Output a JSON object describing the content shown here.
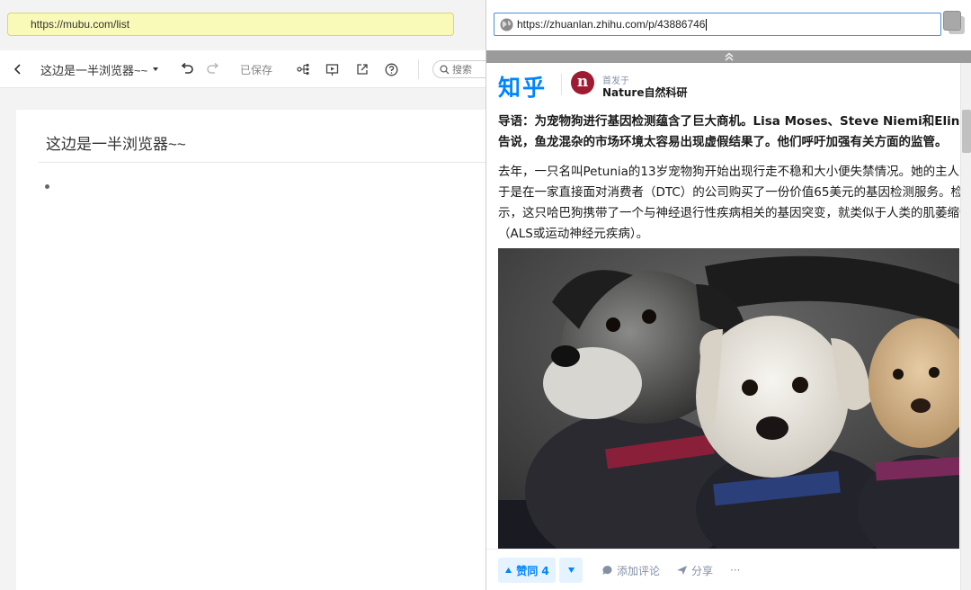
{
  "left_pane": {
    "url": "https://mubu.com/list",
    "toolbar": {
      "doc_name": "这边是一半浏览器~~",
      "saved_label": "已保存",
      "search_placeholder": "搜索"
    },
    "document": {
      "title": "这边是一半浏览器~~"
    }
  },
  "right_pane": {
    "url": "https://zhuanlan.zhihu.com/p/43886746",
    "site_logo": "知乎",
    "column": {
      "prefix": "首发于",
      "name": "Nature自然科研",
      "avatar_letter": "n"
    },
    "article": {
      "lead_lines": [
        "导语：为宠物狗进行基因检测蕴含了巨大商机。Lisa Moses、Steve Niemi和Elinor Karls",
        "告说，鱼龙混杂的市场环境太容易出现虚假结果了。他们呼吁加强有关方面的监管。"
      ],
      "para_lines": [
        "去年，一只名叫Petunia的13岁宠物狗开始出现行走不稳和大小便失禁情况。她的主人十分",
        "于是在一家直接面对消费者（DTC）的公司购买了一份价值65美元的基因检测服务。检测",
        "示，这只哈巴狗携带了一个与神经退行性疾病相关的基因突变，就类似于人类的肌萎缩侧",
        "（ALS或运动神经元疾病）。"
      ]
    },
    "actions": {
      "vote_label": "赞同 4",
      "comment_label": "添加评论",
      "share_label": "分享",
      "more_label": "···"
    },
    "colors": {
      "brand": "#0084ff",
      "vote_bg": "#e5f2ff",
      "nature_red": "#9e1b32"
    }
  }
}
